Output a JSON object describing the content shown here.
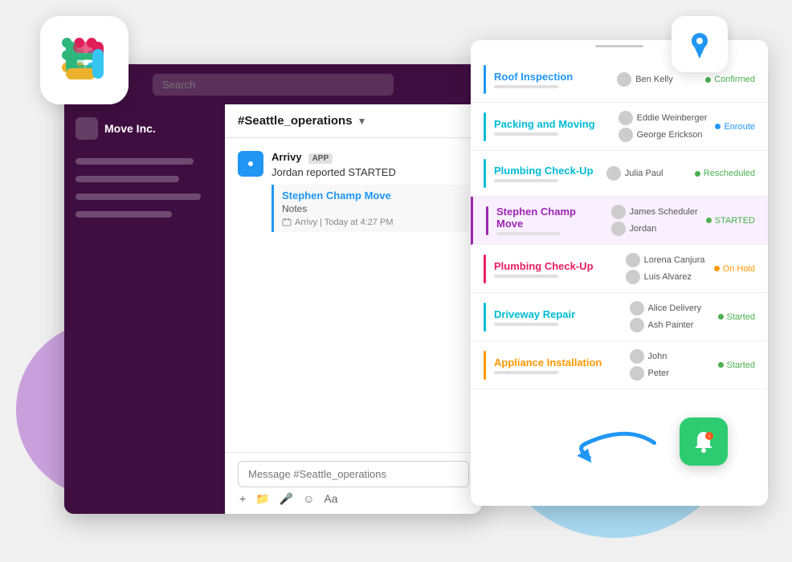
{
  "background": {
    "circle_blue": "lightblue",
    "circle_purple": "plum"
  },
  "slack_logo": {
    "alt": "Slack Logo"
  },
  "topbar": {
    "search_placeholder": "Search"
  },
  "workspace": {
    "name": "Move Inc."
  },
  "channel": {
    "name": "#Seattle_operations",
    "chevron": "▼"
  },
  "sidebar_items": [
    {
      "label": "sidebar-item-1"
    },
    {
      "label": "sidebar-item-2"
    },
    {
      "label": "sidebar-item-3"
    },
    {
      "label": "sidebar-item-4"
    }
  ],
  "message": {
    "sender": "Arrivy",
    "badge": "APP",
    "text": "Jordan reported STARTED",
    "preview": {
      "title": "Stephen Champ Move",
      "subtitle": "Notes",
      "meta": "Arrivy | Today at 4:27 PM"
    }
  },
  "input": {
    "placeholder": "Message #Seattle_operations"
  },
  "toolbar_icons": [
    "+",
    "📁",
    "🎤",
    "😊",
    "Aa"
  ],
  "jobs": [
    {
      "title": "Roof Inspection",
      "title_color": "blue",
      "border_color": "#2196f3",
      "persons": [
        "Ben Kelly"
      ],
      "status": "Confirmed",
      "status_class": "confirmed",
      "status_dot": "green"
    },
    {
      "title": "Packing and Moving",
      "title_color": "teal",
      "border_color": "#00bcd4",
      "persons": [
        "Eddie Weinberger",
        "George Erickson"
      ],
      "status": "Enroute",
      "status_class": "enroute",
      "status_dot": "blue"
    },
    {
      "title": "Plumbing Check-Up",
      "title_color": "teal",
      "border_color": "#00bcd4",
      "persons": [
        "Julia Paul"
      ],
      "status": "Rescheduled",
      "status_class": "rescheduled",
      "status_dot": "green"
    },
    {
      "title": "Stephen Champ Move",
      "title_color": "purple",
      "border_color": "#9c27b0",
      "highlighted": true,
      "persons": [
        "James Scheduler",
        "Jordan"
      ],
      "status": "STARTED",
      "status_class": "started",
      "status_dot": "green"
    },
    {
      "title": "Plumbing Check-Up",
      "title_color": "pink",
      "border_color": "#e91e63",
      "persons": [
        "Lorena Canjura",
        "Luis Alvarez"
      ],
      "status": "On Hold",
      "status_class": "onhold",
      "status_dot": "orange"
    },
    {
      "title": "Driveway Repair",
      "title_color": "cyan",
      "border_color": "#00bcd4",
      "persons": [
        "Alice Delivery",
        "Ash Painter"
      ],
      "status": "Started",
      "status_class": "started",
      "status_dot": "green"
    },
    {
      "title": "Appliance Installation",
      "title_color": "orange",
      "border_color": "#ff9800",
      "persons": [
        "John",
        "Peter"
      ],
      "status": "Started",
      "status_class": "started",
      "status_dot": "green"
    }
  ],
  "icons": {
    "location_pin": "📍",
    "bell": "🔔",
    "arrivy_icon": "📍"
  }
}
